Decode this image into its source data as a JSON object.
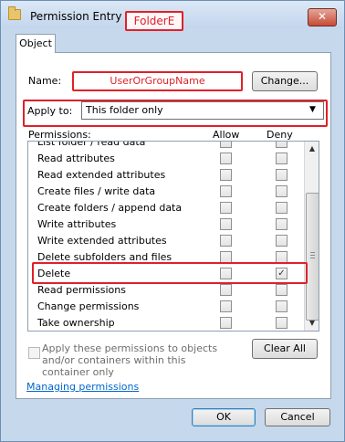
{
  "window": {
    "title": "Permission Entry for",
    "object_name": "FolderE",
    "close_glyph": "✕"
  },
  "tabs": [
    {
      "label": "Object"
    }
  ],
  "name": {
    "label": "Name:",
    "value": "UserOrGroupName",
    "change_label": "Change..."
  },
  "apply_to": {
    "label": "Apply to:",
    "value": "This folder only",
    "arrow": "▼"
  },
  "permissions": {
    "label": "Permissions:",
    "allow_header": "Allow",
    "deny_header": "Deny",
    "rows": [
      {
        "label": "List folder / read data",
        "allow": false,
        "deny": false
      },
      {
        "label": "Read attributes",
        "allow": false,
        "deny": false
      },
      {
        "label": "Read extended attributes",
        "allow": false,
        "deny": false
      },
      {
        "label": "Create files / write data",
        "allow": false,
        "deny": false
      },
      {
        "label": "Create folders / append data",
        "allow": false,
        "deny": false
      },
      {
        "label": "Write attributes",
        "allow": false,
        "deny": false
      },
      {
        "label": "Write extended attributes",
        "allow": false,
        "deny": false
      },
      {
        "label": "Delete subfolders and files",
        "allow": false,
        "deny": false
      },
      {
        "label": "Delete",
        "allow": false,
        "deny": true
      },
      {
        "label": "Read permissions",
        "allow": false,
        "deny": false
      },
      {
        "label": "Change permissions",
        "allow": false,
        "deny": false
      },
      {
        "label": "Take ownership",
        "allow": false,
        "deny": false
      }
    ],
    "check_glyph": "✓",
    "scroll_up": "▲",
    "scroll_down": "▼"
  },
  "inherit": {
    "text": "Apply these permissions to objects and/or containers within this container only",
    "checked": false
  },
  "clear_all_label": "Clear All",
  "managing_link": "Managing permissions",
  "ok_label": "OK",
  "cancel_label": "Cancel",
  "colors": {
    "highlight": "#e0202a",
    "link": "#0066cc"
  }
}
